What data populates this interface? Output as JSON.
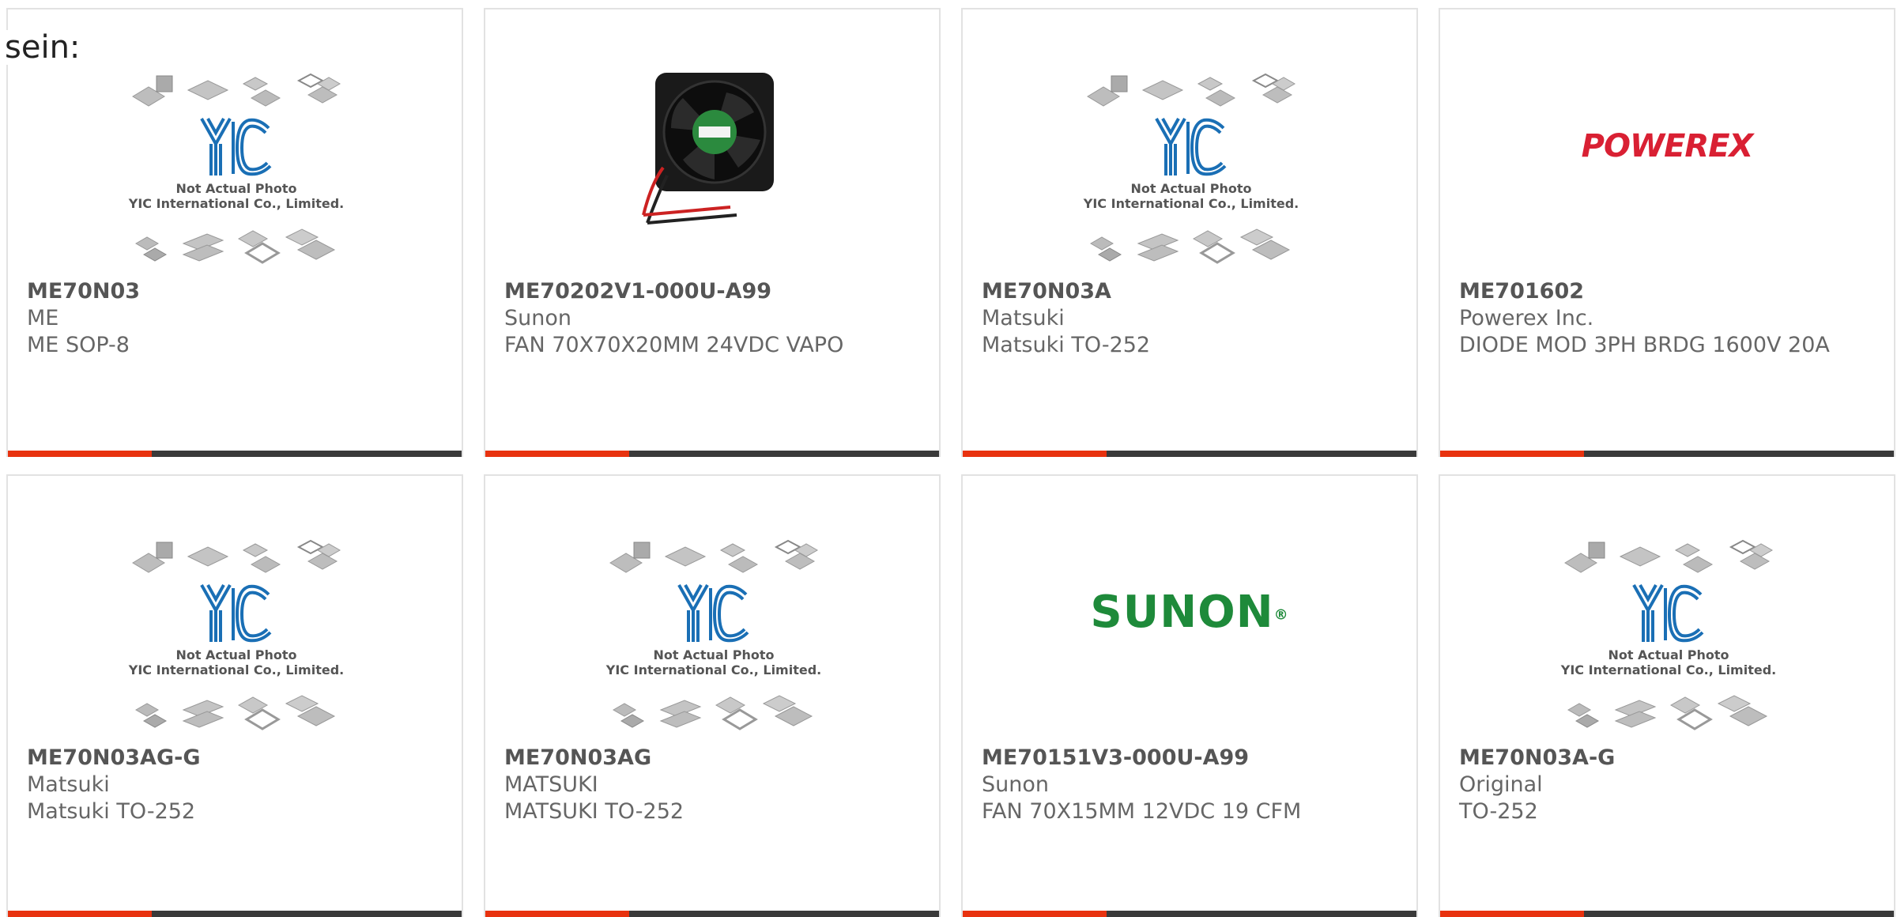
{
  "intro_text": "sein:",
  "placeholder": {
    "line1": "Not Actual Photo",
    "line2": "YIC International Co., Limited."
  },
  "products": [
    {
      "pn": "ME70N03",
      "mfr": "ME",
      "desc": "ME SOP-8",
      "image": "yic-placeholder"
    },
    {
      "pn": "ME70202V1-000U-A99",
      "mfr": "Sunon",
      "desc": "FAN 70X70X20MM 24VDC VAPO",
      "image": "fan-photo"
    },
    {
      "pn": "ME70N03A",
      "mfr": "Matsuki",
      "desc": "Matsuki TO-252",
      "image": "yic-placeholder"
    },
    {
      "pn": "ME701602",
      "mfr": "Powerex Inc.",
      "desc": "DIODE MOD 3PH BRDG 1600V 20A",
      "image": "powerex-logo",
      "logo_text": "POWEREX"
    },
    {
      "pn": "ME70N03AG-G",
      "mfr": "Matsuki",
      "desc": "Matsuki TO-252",
      "image": "yic-placeholder"
    },
    {
      "pn": "ME70N03AG",
      "mfr": "MATSUKI",
      "desc": "MATSUKI TO-252",
      "image": "yic-placeholder"
    },
    {
      "pn": "ME70151V3-000U-A99",
      "mfr": "Sunon",
      "desc": "FAN 70X15MM 12VDC 19 CFM",
      "image": "sunon-logo",
      "logo_text": "SUNON"
    },
    {
      "pn": "ME70N03A-G",
      "mfr": "Original",
      "desc": "TO-252",
      "image": "yic-placeholder"
    }
  ],
  "colors": {
    "accent": "#e8320f",
    "bar": "#3a3a3a",
    "yic_blue": "#1a6fb5",
    "powerex_red": "#d92033",
    "sunon_green": "#1e8a3a"
  }
}
